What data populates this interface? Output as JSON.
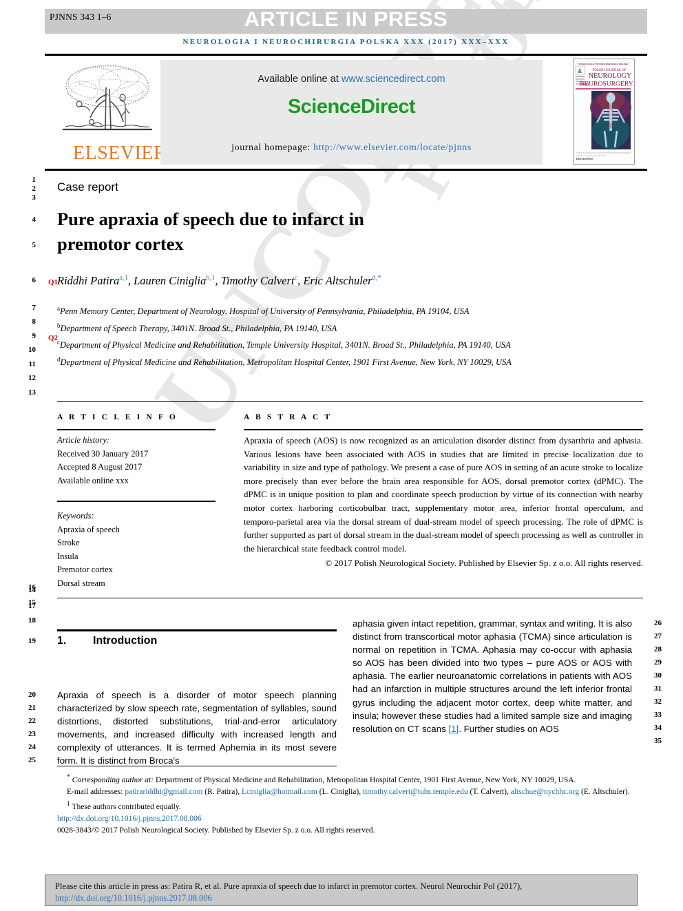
{
  "header": {
    "article_id": "PJNNS 343 1–6",
    "article_in_press": "ARTICLE IN PRESS",
    "journal_running_head": "NEUROLOGIA I NEUROCHIRURGIA POLSKA XXX (2017) XXX–XXX"
  },
  "banner": {
    "publisher_name": "ELSEVIER",
    "available_prefix": "Available online at ",
    "sciencedirect_url": "www.sciencedirect.com",
    "sciencedirect_logo": "ScienceDirect",
    "homepage_label": "journal homepage: ",
    "homepage_url": "http://www.elsevier.com/locate/pjnns",
    "cover": {
      "top_line": "NEUROLOGIA I NEUROCHIRURGIA POLSKA",
      "line1": "POLISH JOURNAL OF",
      "line2": "NEUROLOGY",
      "line3_prefix": "AND ",
      "line3": "NEUROSURGERY",
      "footer": "ElsevierMed"
    }
  },
  "article": {
    "type": "Case report",
    "title_line1": "Pure apraxia of speech due to infarct in",
    "title_line2": "premotor cortex",
    "query_markers": {
      "q1": "Q1",
      "q2": "Q2"
    },
    "authors": [
      {
        "name": "Riddhi Patira",
        "sup": "a,1"
      },
      {
        "name": "Lauren Ciniglia",
        "sup": "b,1"
      },
      {
        "name": "Timothy Calvert",
        "sup": "c"
      },
      {
        "name": "Eric Altschuler",
        "sup": "d,*"
      }
    ],
    "affiliations": [
      {
        "mark": "a",
        "text": "Penn Memory Center, Department of Neurology, Hospital of University of Pennsylvania, Philadelphia, PA 19104, USA"
      },
      {
        "mark": "b",
        "text": "Department of Speech Therapy, 3401N. Broad St., Philadelphia, PA 19140, USA"
      },
      {
        "mark": "c",
        "text": "Department of Physical Medicine and Rehabilitation, Temple University Hospital, 3401N. Broad St., Philadelphia, PA 19140, USA"
      },
      {
        "mark": "d",
        "text": "Department of Physical Medicine and Rehabilitation, Metropolitan Hospital Center, 1901 First Avenue, New York, NY 10029, USA"
      }
    ]
  },
  "article_info": {
    "heading": "A R T I C L E   I N F O",
    "history_label": "Article history:",
    "received": "Received 30 January 2017",
    "accepted": "Accepted 8 August 2017",
    "available_online": "Available online xxx",
    "keywords_label": "Keywords:",
    "keywords": [
      "Apraxia of speech",
      "Stroke",
      "Insula",
      "Premotor cortex",
      "Dorsal stream"
    ]
  },
  "abstract": {
    "heading": "A B S T R A C T",
    "body": "Apraxia of speech (AOS) is now recognized as an articulation disorder distinct from dysarthria and aphasia. Various lesions have been associated with AOS in studies that are limited in precise localization due to variability in size and type of pathology. We present a case of pure AOS in setting of an acute stroke to localize more precisely than ever before the brain area responsible for AOS, dorsal premotor cortex (dPMC). The dPMC is in unique position to plan and coordinate speech production by virtue of its connection with nearby motor cortex harboring corticobulbar tract, supplementary motor area, inferior frontal operculum, and temporo-parietal area via the dorsal stream of dual-stream model of speech processing. The role of dPMC is further supported as part of dorsal stream in the dual-stream model of speech processing as well as controller in the hierarchical state feedback control model.",
    "copyright": "© 2017 Polish Neurological Society. Published by Elsevier Sp. z o.o. All rights reserved."
  },
  "body": {
    "section_number": "1.",
    "section_title": "Introduction",
    "left_column": "Apraxia of speech is a disorder of motor speech planning characterized by slow speech rate, segmentation of syllables, sound distortions, distorted substitutions, trial-and-error articulatory movements, and increased difficulty with increased length and complexity of utterances. It is termed Aphemia in its most severe form. It is distinct from Broca's",
    "right_column_part1": "aphasia given intact repetition, grammar, syntax and writing. It is also distinct from transcortical motor aphasia (TCMA) since articulation is normal on repetition in TCMA. Aphasia may co-occur with aphasia so AOS has been divided into two types – pure AOS or AOS with aphasia. The earlier neuroanatomic correlations in patients with AOS had an infarction in multiple structures around the left inferior frontal gyrus including the adjacent motor cortex, deep white matter, and insula; however these studies had a limited sample size and imaging resolution on CT scans ",
    "right_column_ref": "[1]",
    "right_column_part2": ". Further studies on AOS"
  },
  "footnotes": {
    "corresponding_label": "Corresponding author at:",
    "corresponding_text": " Department of Physical Medicine and Rehabilitation, Metropolitan Hospital Center, 1901 First Avenue, New York, NY 10029, USA.",
    "email_label": "E-mail addresses:",
    "emails": [
      {
        "address": "patirariddhi@gmail.com",
        "person": "(R. Patira)"
      },
      {
        "address": "Lciniglia@hotmail.com",
        "person": "(L. Ciniglia)"
      },
      {
        "address": "timothy.calvert@tuhs.temple.edu",
        "person": "(T. Calvert)"
      },
      {
        "address": "altschue@nychhc.org",
        "person": "(E. Altschuler)"
      }
    ],
    "equal_contribution": "These authors contributed equally.",
    "doi_url": "http://dx.doi.org/10.1016/j.pjnns.2017.08.006",
    "issn_line": "0028-3843/© 2017 Polish Neurological Society. Published by Elsevier Sp. z o.o. All rights reserved."
  },
  "cite_box": {
    "text": "Please cite this article in press as: Patira R, et al. Pure apraxia of speech due to infarct in premotor cortex. Neurol Neurochir Pol (2017), ",
    "url": "http://dx.doi.org/10.1016/j.pjnns.2017.08.006"
  },
  "watermark": {
    "text1": "PROOF",
    "text2": "UNCORRECTED"
  },
  "line_numbers": {
    "left": [
      "1",
      "2",
      "3",
      "4",
      "5",
      "6",
      "7",
      "8",
      "9",
      "10",
      "11",
      "12",
      "13",
      "14",
      "15",
      "16",
      "17",
      "18",
      "19",
      "20",
      "21",
      "22",
      "23",
      "24",
      "25"
    ],
    "right": [
      "26",
      "27",
      "28",
      "29",
      "30",
      "31",
      "32",
      "33",
      "34",
      "35"
    ]
  },
  "colors": {
    "link": "#2a6ebb",
    "journal_head": "#175c8e",
    "sciencedirect_green": "#1a9a26",
    "elsevier_orange": "#e87722",
    "query_red": "#e10000",
    "bar_gray": "#c9c9c9"
  }
}
